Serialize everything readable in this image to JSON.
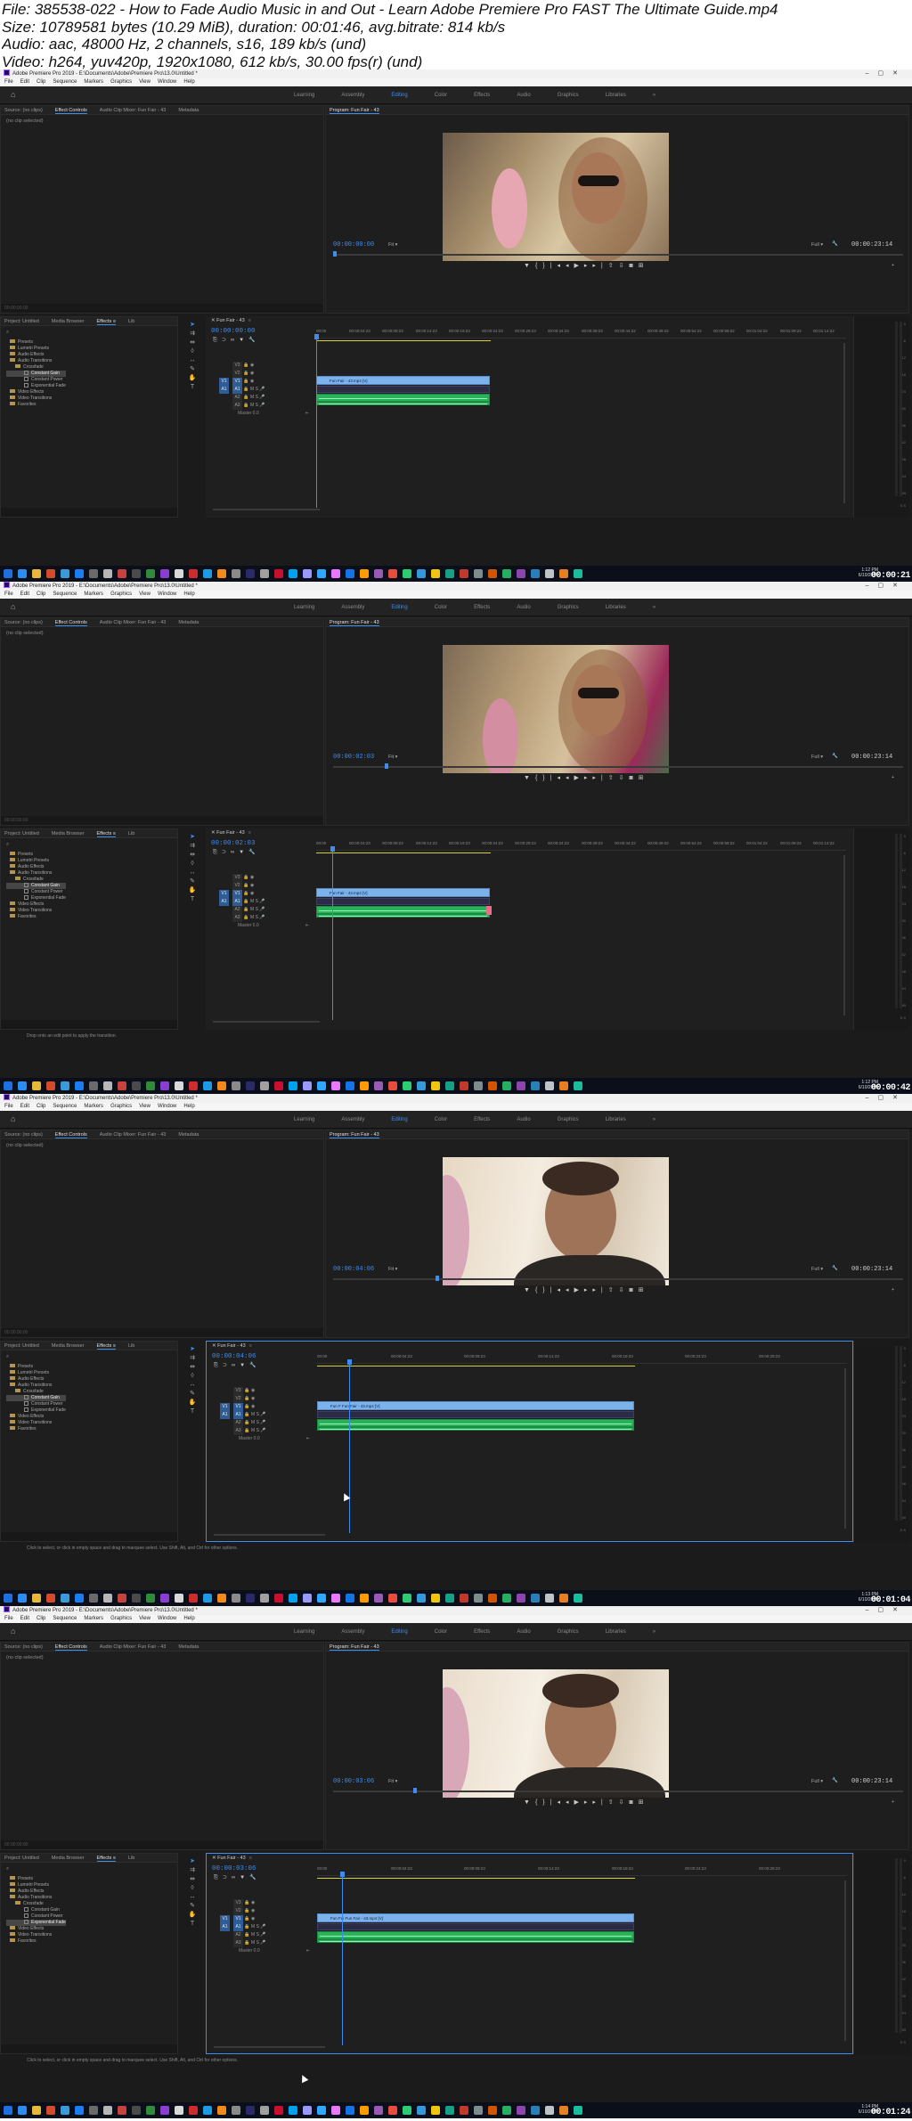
{
  "file_info": {
    "line1": "File: 385538-022 - How to Fade Audio Music in and Out - Learn Adobe Premiere Pro FAST  The Ultimate Guide.mp4",
    "line2": "Size: 10789581 bytes (10.29 MiB), duration: 00:01:46, avg.bitrate: 814 kb/s",
    "line3": "Audio: aac, 48000 Hz, 2 channels, s16, 189 kb/s (und)",
    "line4": "Video: h264, yuv420p, 1920x1080, 612 kb/s, 30.00 fps(r) (und)"
  },
  "app": {
    "title": "Adobe Premiere Pro 2019 - E:\\Documents\\Adobe\\Premiere Pro\\13.0\\Untitled *",
    "menu": [
      "File",
      "Edit",
      "Clip",
      "Sequence",
      "Markers",
      "Graphics",
      "View",
      "Window",
      "Help"
    ],
    "workspaces": [
      "Learning",
      "Assembly",
      "Editing",
      "Color",
      "Effects",
      "Audio",
      "Graphics",
      "Libraries",
      "»"
    ],
    "source_tabs": [
      "Source: (no clips)",
      "Effect Controls",
      "Audio Clip Mixer: Fun Fair - 43",
      "Metadata"
    ],
    "no_clip_selected": "(no clip selected)",
    "program_title": "Program: Fun Fair - 43",
    "fit_label": "Fit",
    "full_label": "Full",
    "project_tabs": [
      "Project: Untitled",
      "Media Browser",
      "Effects",
      "Lib"
    ],
    "effects_tree": [
      "Presets",
      "Lumetri Presets",
      "Audio Effects",
      "Audio Transitions",
      "Crossfade",
      "Constant Gain",
      "Constant Power",
      "Exponential Fade",
      "Video Effects",
      "Video Transitions",
      "Favorites"
    ],
    "sequence_tab": "Fun Fair - 43",
    "tracks_video": [
      "V3",
      "V2",
      "V1"
    ],
    "tracks_audio": [
      "A1",
      "A2",
      "A3"
    ],
    "master_label": "Master",
    "master_value": "0.0",
    "ruler_ticks": [
      "00:00",
      "00:00:04:23",
      "00:00:09:23",
      "00:00:14:23",
      "00:00:19:23",
      "00:00:24:23",
      "00:00:29:23",
      "00:00:34:23",
      "00:00:39:23",
      "00:00:44:22",
      "00:00:49:22",
      "00:00:54:22",
      "00:00:59:22",
      "00:01:04:22",
      "00:01:09:22",
      "00:01:14:22"
    ],
    "ruler_ticks_zoom": [
      "00:00",
      "00:00:04:23",
      "00:00:09:23",
      "00:00:14:23",
      "00:00:19:23",
      "00:00:24:23",
      "00:00:29:23"
    ],
    "meter_scale": [
      "0",
      "-6",
      "-12",
      "-18",
      "-24",
      "-30",
      "-36",
      "-42",
      "-48",
      "-54",
      "dB"
    ],
    "meter_solo": "S  S",
    "duration": "00:00:23:14"
  },
  "frames": [
    {
      "program_time": "00:00:00:00",
      "timeline_time": "00:00:00:00",
      "clip_label": "Fun Fair - 43.mp4 [V]",
      "status": "",
      "clock": "1:12 PM\n6/10/2019",
      "watermark": "00:00:21",
      "playhead_frac": 0.0,
      "zoom": "wide",
      "selected_tool_hint": "Constant Gain"
    },
    {
      "program_time": "00:00:02:03",
      "timeline_time": "00:00:02:03",
      "clip_label": "Fun Fair - 43.mp4 [V]",
      "status": "Drop onto an edit point to apply the transition.",
      "clock": "1:12 PM\n6/10/2019",
      "watermark": "00:00:42",
      "playhead_frac": 0.09,
      "zoom": "wide",
      "selected_tool_hint": "Constant Gain"
    },
    {
      "program_time": "00:00:04:06",
      "timeline_time": "00:00:04:06",
      "clip_label": "Fun Fair - 43.mp4 [V]",
      "clip_prefix": "Fun F",
      "status": "Click to select, or click in empty space and drag to marquee select. Use Shift, Alt, and Ctrl for other options.",
      "clock": "1:13 PM\n6/10/2019",
      "watermark": "00:01:04",
      "playhead_frac": 0.18,
      "zoom": "zoom",
      "selected_tool_hint": "Constant Gain"
    },
    {
      "program_time": "00:00:03:06",
      "timeline_time": "00:00:03:06",
      "clip_label": "Fun Fair - 43.mp4 [V]",
      "clip_prefix": "Fun Fai",
      "status": "Click to select, or click in empty space and drag to marquee select. Use Shift, Alt, and Ctrl for other options.",
      "clock": "1:14 PM\n6/10/2019",
      "watermark": "00:01:24",
      "playhead_frac": 0.14,
      "zoom": "zoom",
      "selected_tool_hint": "Exponential Fade"
    }
  ],
  "colors": {
    "accent": "#3d8cf0",
    "video_clip": "#7cb2ec",
    "audio_clip": "#28b25a",
    "ruler_bar": "#d4cf3a",
    "panel_bg": "#1e1e1e"
  },
  "icons": [
    "home-icon",
    "wrench-icon",
    "play-icon",
    "step-back-icon",
    "step-forward-icon",
    "marker-icon",
    "camera-icon",
    "selection-tool-icon",
    "razor-tool-icon",
    "hand-tool-icon",
    "pen-tool-icon",
    "text-tool-icon",
    "eye-icon",
    "lock-icon",
    "mic-icon",
    "folder-icon"
  ]
}
